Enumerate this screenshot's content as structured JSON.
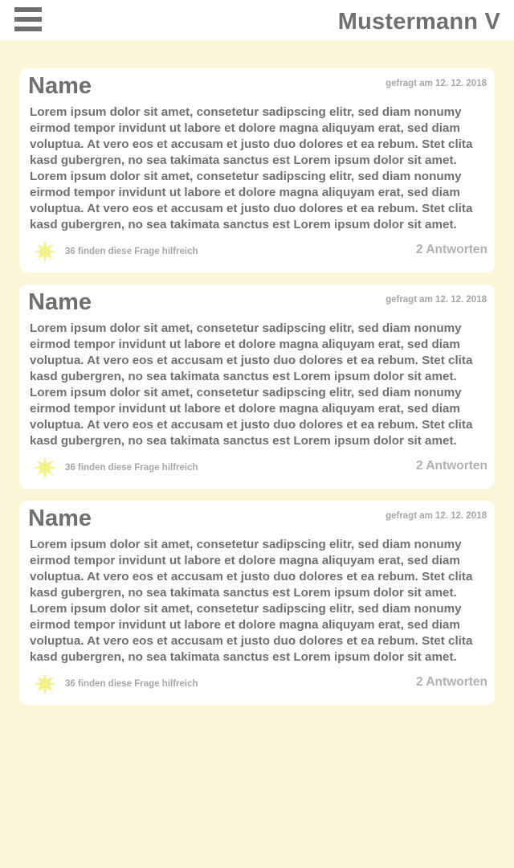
{
  "header": {
    "user_name": "Mustermann V",
    "menu_icon": "hamburger-menu-icon"
  },
  "questions": [
    {
      "name": "Name",
      "date": "gefragt am 12. 12. 2018",
      "text": "Lorem ipsum dolor sit amet, consetetur sadipscing elitr, sed diam nonumy eirmod tempor invidunt ut labore et dolore magna aliquyam erat, sed diam voluptua. At vero eos et accusam et justo duo dolores et ea rebum. Stet clita kasd gubergren, no sea takimata sanctus est Lorem ipsum dolor sit amet. Lorem ipsum dolor sit amet, consetetur sadipscing elitr, sed diam nonumy eirmod tempor invidunt ut labore et dolore magna aliquyam erat, sed diam voluptua. At vero eos et accusam et justo duo dolores et ea rebum. Stet clita kasd gubergren, no sea takimata sanctus est Lorem ipsum dolor sit amet.",
      "helpful": "36 finden diese Frage hilfreich",
      "answers": "2 Antworten"
    },
    {
      "name": "Name",
      "date": "gefragt am 12. 12. 2018",
      "text": "Lorem ipsum dolor sit amet, consetetur sadipscing elitr, sed diam nonumy eirmod tempor invidunt ut labore et dolore magna aliquyam erat, sed diam voluptua. At vero eos et accusam et justo duo dolores et ea rebum. Stet clita kasd gubergren, no sea takimata sanctus est Lorem ipsum dolor sit amet. Lorem ipsum dolor sit amet, consetetur sadipscing elitr, sed diam nonumy eirmod tempor invidunt ut labore et dolore magna aliquyam erat, sed diam voluptua. At vero eos et accusam et justo duo dolores et ea rebum. Stet clita kasd gubergren, no sea takimata sanctus est Lorem ipsum dolor sit amet.",
      "helpful": "36 finden diese Frage hilfreich",
      "answers": "2 Antworten"
    },
    {
      "name": "Name",
      "date": "gefragt am 12. 12. 2018",
      "text": "Lorem ipsum dolor sit amet, consetetur sadipscing elitr, sed diam nonumy eirmod tempor invidunt ut labore et dolore magna aliquyam erat, sed diam voluptua. At vero eos et accusam et justo duo dolores et ea rebum. Stet clita kasd gubergren, no sea takimata sanctus est Lorem ipsum dolor sit amet. Lorem ipsum dolor sit amet, consetetur sadipscing elitr, sed diam nonumy eirmod tempor invidunt ut labore et dolore magna aliquyam erat, sed diam voluptua. At vero eos et accusam et justo duo dolores et ea rebum. Stet clita kasd gubergren, no sea takimata sanctus est Lorem ipsum dolor sit amet.",
      "helpful": "36 finden diese Frage hilfreich",
      "answers": "2 Antworten"
    }
  ],
  "colors": {
    "background": "#FBF7D6",
    "card": "#FFFFFF",
    "text": "#6F6F6F",
    "muted": "#A5A5A5",
    "star": "#F5F28A"
  },
  "icons": {
    "star": "star-icon"
  }
}
